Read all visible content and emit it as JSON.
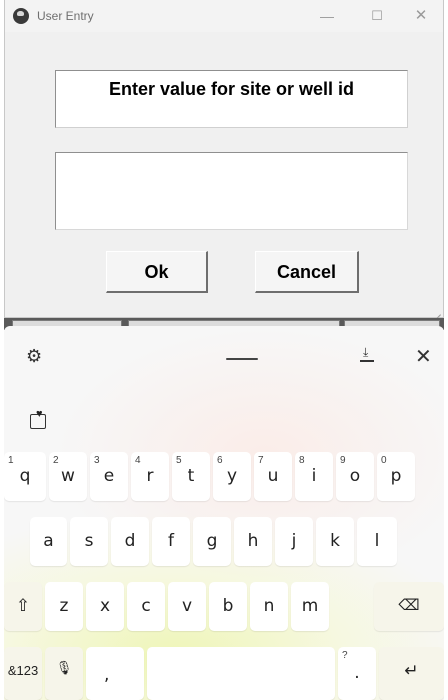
{
  "window": {
    "title": "User Entry",
    "controls": {
      "minimize": "—",
      "maximize": "☐",
      "close": "✕"
    }
  },
  "dialog": {
    "prompt": "Enter value for site or well id",
    "input_value": "",
    "ok_label": "Ok",
    "cancel_label": "Cancel"
  },
  "keyboard": {
    "toolbar": {
      "settings_icon": "⚙",
      "dock_arrow": "⤓",
      "close_icon": "✕"
    },
    "emoji_icon": "heart-sticker",
    "row1": [
      {
        "num": "1",
        "char": "q"
      },
      {
        "num": "2",
        "char": "w"
      },
      {
        "num": "3",
        "char": "e"
      },
      {
        "num": "4",
        "char": "r"
      },
      {
        "num": "5",
        "char": "t"
      },
      {
        "num": "6",
        "char": "y"
      },
      {
        "num": "7",
        "char": "u"
      },
      {
        "num": "8",
        "char": "i"
      },
      {
        "num": "9",
        "char": "o"
      },
      {
        "num": "0",
        "char": "p"
      }
    ],
    "row2": [
      "a",
      "s",
      "d",
      "f",
      "g",
      "h",
      "j",
      "k",
      "l"
    ],
    "row3": [
      "z",
      "x",
      "c",
      "v",
      "b",
      "n",
      "m"
    ],
    "shift_glyph": "⇧",
    "backspace_glyph": "⌫",
    "symbols_label": "&123",
    "mic_glyph": "🎙",
    "comma_char": ",",
    "period_hint": "?",
    "period_char": ".",
    "enter_glyph": "↵"
  }
}
